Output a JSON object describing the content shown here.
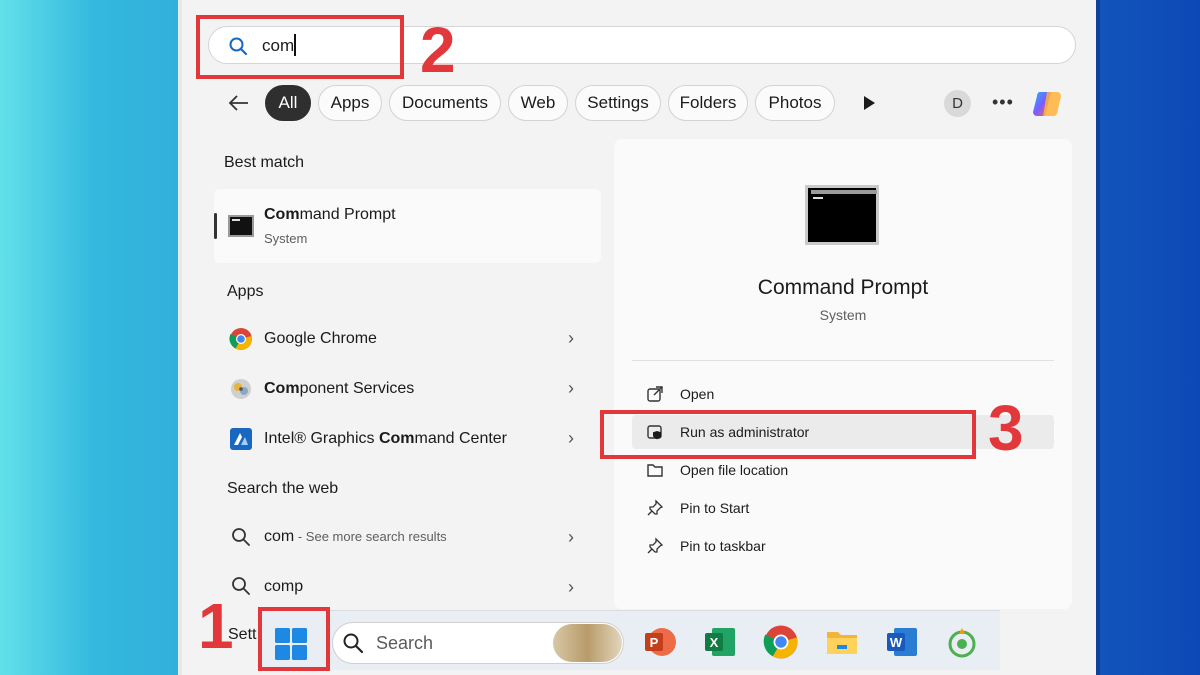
{
  "search": {
    "query": "com"
  },
  "filters": {
    "tabs": [
      "All",
      "Apps",
      "Documents",
      "Web",
      "Settings",
      "Folders",
      "Photos"
    ],
    "avatar_letter": "D",
    "more": "•••"
  },
  "best_match": {
    "heading": "Best match",
    "title_bold": "Com",
    "title_rest": "mand Prompt",
    "subtitle": "System"
  },
  "apps": {
    "heading": "Apps",
    "items": [
      {
        "pre": "",
        "bold": "",
        "rest": "Google Chrome",
        "icon": "chrome-icon"
      },
      {
        "pre": "",
        "bold": "Com",
        "rest": "ponent Services",
        "icon": "component-services-icon"
      },
      {
        "pre": "Intel® Graphics ",
        "bold": "Com",
        "rest": "mand Center",
        "icon": "intel-graphics-icon"
      }
    ]
  },
  "web": {
    "heading": "Search the web",
    "items": [
      {
        "text": "com",
        "suffix": " - See more search results"
      },
      {
        "text": "comp",
        "suffix": ""
      }
    ]
  },
  "settings_partial": "Sett",
  "detail": {
    "title": "Command Prompt",
    "subtitle": "System",
    "actions": [
      "Open",
      "Run as administrator",
      "Open file location",
      "Pin to Start",
      "Pin to taskbar"
    ]
  },
  "taskbar": {
    "search_placeholder": "Search"
  },
  "annotations": [
    "1",
    "2",
    "3"
  ],
  "colors": {
    "annotation_red": "#e2383c",
    "accent_dark": "#2f2f2f"
  }
}
